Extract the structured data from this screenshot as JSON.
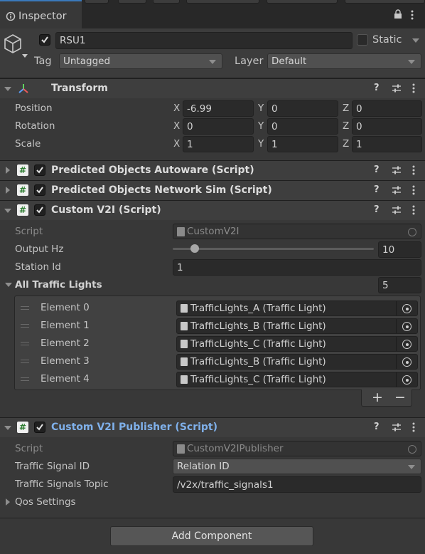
{
  "tab": {
    "label": "Inspector"
  },
  "object": {
    "name": "RSU1",
    "static_label": "Static",
    "tag_label": "Tag",
    "tag_value": "Untagged",
    "layer_label": "Layer",
    "layer_value": "Default"
  },
  "transform": {
    "title": "Transform",
    "rows": [
      {
        "label": "Position",
        "x": "-6.99",
        "y": "0",
        "z": "0"
      },
      {
        "label": "Rotation",
        "x": "0",
        "y": "0",
        "z": "0"
      },
      {
        "label": "Scale",
        "x": "1",
        "y": "1",
        "z": "1"
      }
    ],
    "axis": {
      "x": "X",
      "y": "Y",
      "z": "Z"
    }
  },
  "components": {
    "autoware": "Predicted Objects Autoware (Script)",
    "netsim": "Predicted Objects Network Sim (Script)"
  },
  "v2i": {
    "title": "Custom V2I (Script)",
    "script_label": "Script",
    "script_value": "CustomV2I",
    "hz_label": "Output Hz",
    "hz_value": "10",
    "hz_fraction": 0.11,
    "station_label": "Station Id",
    "station_value": "1",
    "lights_label": "All Traffic Lights",
    "lights_count": "5",
    "elements": [
      {
        "label": "Element 0",
        "value": "TrafficLights_A (Traffic Light)"
      },
      {
        "label": "Element 1",
        "value": "TrafficLights_B (Traffic Light)"
      },
      {
        "label": "Element 2",
        "value": "TrafficLights_C (Traffic Light)"
      },
      {
        "label": "Element 3",
        "value": "TrafficLights_B (Traffic Light)"
      },
      {
        "label": "Element 4",
        "value": "TrafficLights_C (Traffic Light)"
      }
    ],
    "plus": "+",
    "minus": "−"
  },
  "publisher": {
    "title": "Custom V2I Publisher (Script)",
    "script_label": "Script",
    "script_value": "CustomV2IPublisher",
    "signal_label": "Traffic Signal ID",
    "signal_value": "Relation ID",
    "topic_label": "Traffic Signals Topic",
    "topic_value": "/v2x/traffic_signals1",
    "qos_label": "Qos Settings"
  },
  "add_component": "Add Component",
  "colors": {
    "accent": "#3a79bb",
    "link_title": "#7fb0ea",
    "panel": "#383838"
  }
}
